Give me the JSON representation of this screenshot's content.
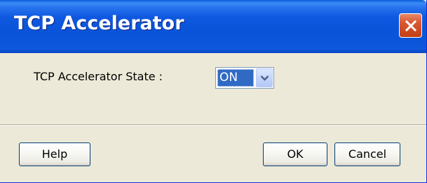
{
  "window": {
    "title": "TCP Accelerator"
  },
  "form": {
    "state_label": "TCP Accelerator State :",
    "state_value": "ON"
  },
  "buttons": {
    "help": "Help",
    "ok": "OK",
    "cancel": "Cancel"
  },
  "icons": {
    "close": "close-icon",
    "dropdown": "chevron-down-icon"
  },
  "colors": {
    "titlebar": "#0A54DA",
    "close_button": "#D4532A",
    "selection": "#316AC5",
    "face": "#ECE9D8"
  }
}
